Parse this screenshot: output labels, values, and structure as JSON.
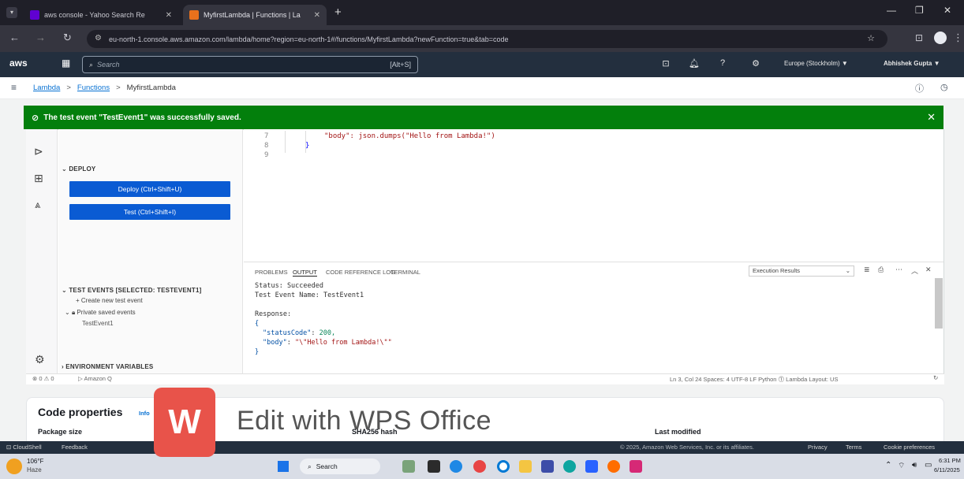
{
  "browser": {
    "tabs": [
      {
        "title": "aws console - Yahoo Search Re",
        "favicon_color": "#6001d2"
      },
      {
        "title": "MyfirstLambda | Functions | La",
        "favicon_color": "#e9711c",
        "active": true
      }
    ],
    "new_tab": "+",
    "url": "eu-north-1.console.aws.amazon.com/lambda/home?region=eu-north-1#/functions/MyfirstLambda?newFunction=true&tab=code"
  },
  "aws_nav": {
    "logo": "aws",
    "search_placeholder": "Search",
    "search_shortcut": "[Alt+S]",
    "region": "Europe (Stockholm) ▼",
    "user": "Abhishek Gupta ▼"
  },
  "breadcrumb": {
    "items": [
      "Lambda",
      "Functions",
      "MyfirstLambda"
    ],
    "separator": ">"
  },
  "flash": {
    "message": "The test event \"TestEvent1\" was successfully saved.",
    "close": "✕"
  },
  "explorer": {
    "deploy_header": "DEPLOY",
    "deploy_button": "Deploy (Ctrl+Shift+U)",
    "test_button": "Test (Ctrl+Shift+I)",
    "test_events_header": "TEST EVENTS [SELECTED: TESTEVENT1]",
    "create_event": "Create new test event",
    "private_events": "Private saved events",
    "saved_event": "TestEvent1",
    "env_header": "ENVIRONMENT VARIABLES"
  },
  "code": {
    "lines": [
      {
        "num": "7",
        "text": "\"body\": json.dumps(\"Hello from Lambda!\")"
      },
      {
        "num": "8",
        "text": "}"
      },
      {
        "num": "9",
        "text": ""
      }
    ]
  },
  "panel": {
    "tabs": [
      "PROBLEMS",
      "OUTPUT",
      "CODE REFERENCE LOG",
      "TERMINAL"
    ],
    "active_tab": "OUTPUT",
    "dropdown": "Execution Results",
    "output": {
      "status": "Status: Succeeded",
      "test_event": "Test Event Name: TestEvent1",
      "response_label": "Response:",
      "open_brace": "{",
      "status_code_key": "\"statusCode\"",
      "status_code_val": "200,",
      "body_key": "\"body\"",
      "body_val": "\"\\\"Hello from Lambda!\\\"\"",
      "close_brace": "}"
    }
  },
  "status_bar": {
    "left": "⊗ 0 ⚠ 0",
    "amazon_q": "▷ Amazon Q",
    "right": "Ln 3, Col 24   Spaces: 4   UTF-8   LF   Python   ⓵ Lambda   Layout: US"
  },
  "properties": {
    "title": "Code properties",
    "info": "Info",
    "package_size": "Package size",
    "sha": "SHA256 hash",
    "last_modified": "Last modified"
  },
  "footer": {
    "cloudshell": "CloudShell",
    "feedback": "Feedback",
    "copyright": "© 2025, Amazon Web Services, Inc. or its affiliates.",
    "privacy": "Privacy",
    "terms": "Terms",
    "cookies": "Cookie preferences"
  },
  "taskbar": {
    "weather_temp": "106°F",
    "weather_desc": "Haze",
    "search": "Search",
    "time": "6:31 PM",
    "date": "6/11/2025"
  },
  "watermark": {
    "logo": "W",
    "text": "Edit with WPS Office"
  }
}
